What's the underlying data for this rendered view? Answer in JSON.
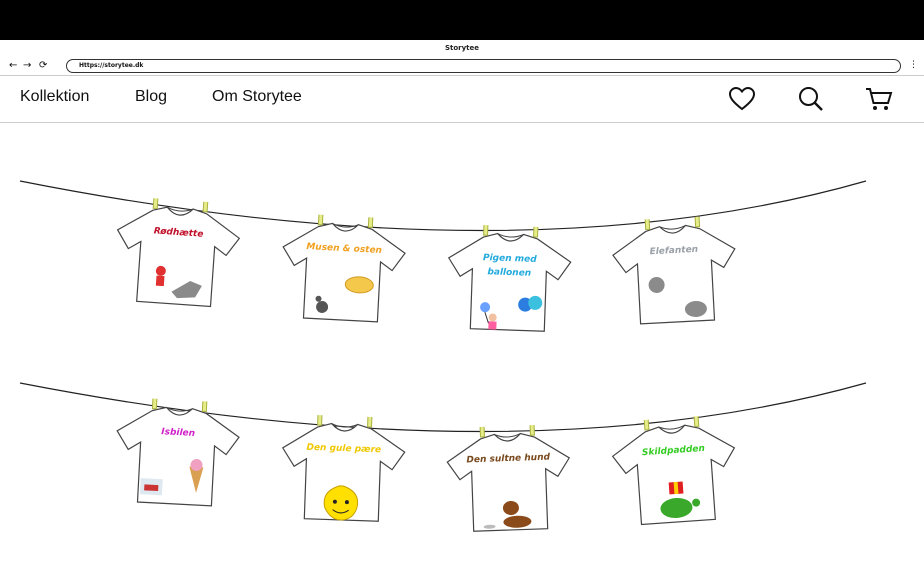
{
  "window": {
    "title": "Storytee"
  },
  "toolbar": {
    "back": "←",
    "forward": "→",
    "reload": "⟳",
    "url": "Https://storytee.dk",
    "menu": "⋮"
  },
  "nav": {
    "links": [
      "Kollektion",
      "Blog",
      "Om Storytee"
    ]
  },
  "icons": {
    "wishlist": "heart-icon",
    "search": "search-icon",
    "cart": "cart-icon"
  },
  "shirts": [
    {
      "title": "Rødhætte",
      "color": "#c0102a"
    },
    {
      "title": "Musen & osten",
      "color": "#f0a020"
    },
    {
      "title": "Pigen med ballonen",
      "color": "#22aadd"
    },
    {
      "title": "Elefanten",
      "color": "#9aa0a8"
    },
    {
      "title": "Isbilen",
      "color": "#d020c8"
    },
    {
      "title": "Den gule pære",
      "color": "#f0c800"
    },
    {
      "title": "Den sultne hund",
      "color": "#7a4a1e"
    },
    {
      "title": "Skildpadden",
      "color": "#33cc22"
    }
  ]
}
